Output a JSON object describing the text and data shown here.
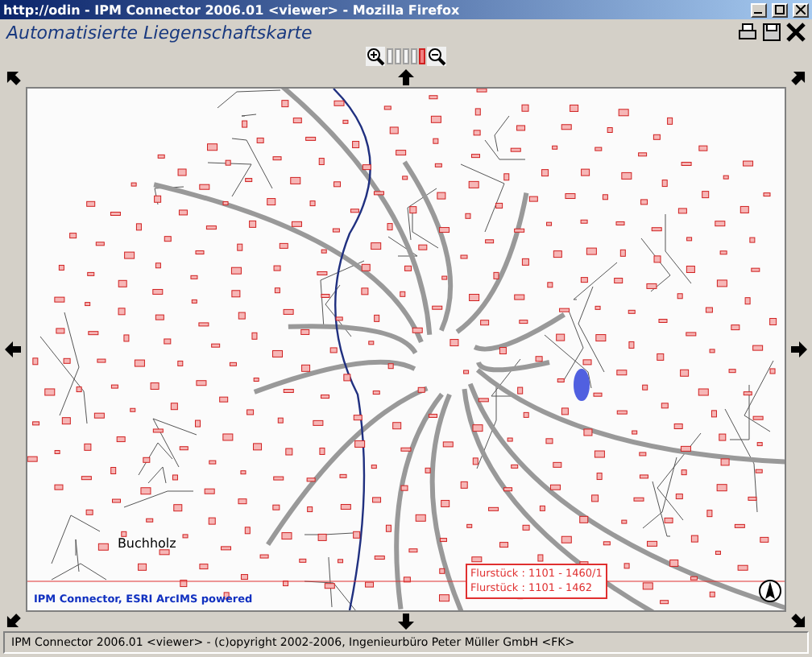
{
  "window": {
    "title": "http://odin - IPM Connector 2006.01 <viewer> - Mozilla Firefox"
  },
  "app": {
    "title": "Automatisierte Liegenschaftskarte"
  },
  "zoom_levels": [
    {
      "selected": false
    },
    {
      "selected": false
    },
    {
      "selected": false
    },
    {
      "selected": false
    },
    {
      "selected": true
    }
  ],
  "map": {
    "place_label": "Buchholz",
    "parcel_labels": [
      "Flurstück : 1101 - 1460/1",
      "Flurstück : 1101 - 1462"
    ],
    "credit": "IPM Connector, ESRI ArcIMS powered"
  },
  "status_bar": "IPM Connector 2006.01 <viewer> - (c)opyright 2002-2006, Ingenieurbüro Peter Müller GmbH <FK>"
}
